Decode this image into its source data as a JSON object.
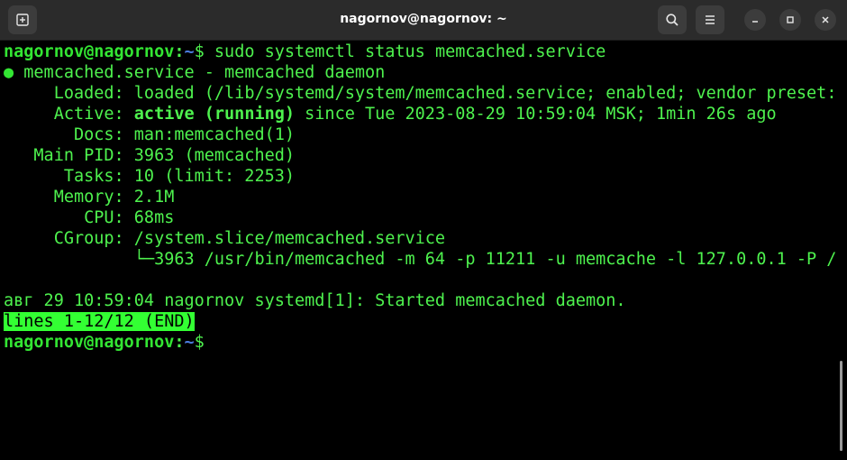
{
  "window": {
    "title": "nagornov@nagornov: ~",
    "icons": {
      "new_tab": "new-tab-icon",
      "search": "search-icon",
      "menu": "hamburger-menu-icon",
      "minimize": "minimize-icon",
      "maximize": "maximize-icon",
      "close": "close-icon"
    }
  },
  "terminal": {
    "prompt_user": "nagornov@nagornov",
    "prompt_sep": ":",
    "prompt_path": "~",
    "prompt_char": "$",
    "command": " sudo systemctl status memcached.service",
    "status_dot": "●",
    "unit_line": " memcached.service - memcached daemon",
    "loaded_label": "     Loaded: ",
    "loaded_value": "loaded (/lib/systemd/system/memcached.service; enabled; vendor preset:",
    "overflow_mark": ">",
    "active_label": "     Active: ",
    "active_state": "active (running)",
    "active_since": " since Tue 2023-08-29 10:59:04 MSK; 1min 26s ago",
    "docs_line": "       Docs: man:memcached(1)",
    "mainpid_line": "   Main PID: 3963 (memcached)",
    "tasks_line": "      Tasks: 10 (limit: 2253)",
    "memory_line": "     Memory: 2.1M",
    "cpu_line": "        CPU: 68ms",
    "cgroup_line": "     CGroup: /system.slice/memcached.service",
    "process_line": "             └─3963 /usr/bin/memcached -m 64 -p 11211 -u memcache -l 127.0.0.1 -P /",
    "log_line": "авг 29 10:59:04 nagornov systemd[1]: Started memcached daemon.",
    "pager_status": "lines 1-12/12 (END)"
  },
  "colors": {
    "background": "#000000",
    "text_green": "#4ef24e",
    "prompt_green": "#33e633",
    "path_blue": "#4c7de0",
    "highlight": "#33ff33",
    "titlebar": "#2b2b2b"
  }
}
